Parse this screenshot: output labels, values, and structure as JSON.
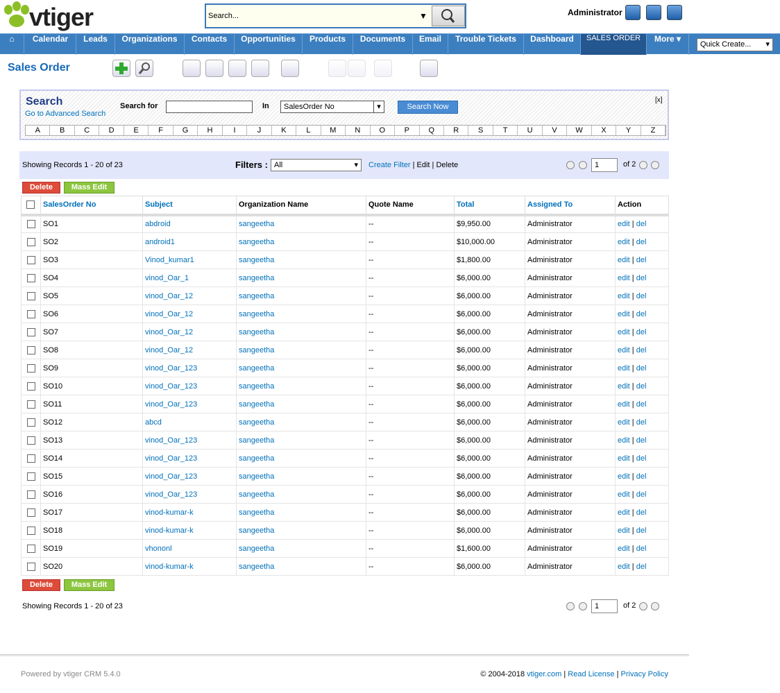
{
  "app": {
    "logo_text": "vtiger",
    "global_search_placeholder": "Search...",
    "user": "Administrator"
  },
  "nav": {
    "items": [
      "Calendar",
      "Leads",
      "Organizations",
      "Contacts",
      "Opportunities",
      "Products",
      "Documents",
      "Email",
      "Trouble Tickets",
      "Dashboard",
      "SALES ORDER",
      "More"
    ],
    "active": "SALES ORDER",
    "more_arrow": "▾",
    "quick_create": "Quick Create...",
    "home_icon": "house-icon"
  },
  "module": {
    "title": "Sales Order"
  },
  "search": {
    "title": "Search",
    "advanced_link": "Go to Advanced Search",
    "search_for_label": "Search for",
    "search_for_value": "",
    "in_label": "In",
    "in_value": "SalesOrder No",
    "button": "Search Now",
    "close": "[x]",
    "alphabet": [
      "A",
      "B",
      "C",
      "D",
      "E",
      "F",
      "G",
      "H",
      "I",
      "J",
      "K",
      "L",
      "M",
      "N",
      "O",
      "P",
      "Q",
      "R",
      "S",
      "T",
      "U",
      "V",
      "W",
      "X",
      "Y",
      "Z"
    ]
  },
  "filter": {
    "showing": "Showing Records 1 - 20 of 23",
    "label": "Filters :",
    "value": "All",
    "create": "Create Filter",
    "sep1": " | ",
    "edit": "Edit",
    "sep2": " | ",
    "delete": "Delete",
    "page": "1",
    "of": "of 2"
  },
  "actions": {
    "delete": "Delete",
    "mass_edit": "Mass Edit"
  },
  "table": {
    "headers": [
      "SalesOrder No",
      "Subject",
      "Organization Name",
      "Quote Name",
      "Total",
      "Assigned To",
      "Action"
    ],
    "action_edit": "edit",
    "action_sep": " | ",
    "action_del": "del",
    "rows": [
      [
        "SO1",
        "abdroid",
        "sangeetha",
        "--",
        "$9,950.00",
        "Administrator"
      ],
      [
        "SO2",
        "android1",
        "sangeetha",
        "--",
        "$10,000.00",
        "Administrator"
      ],
      [
        "SO3",
        "Vinod_kumar1",
        "sangeetha",
        "--",
        "$1,800.00",
        "Administrator"
      ],
      [
        "SO4",
        "vinod_Oar_1",
        "sangeetha",
        "--",
        "$6,000.00",
        "Administrator"
      ],
      [
        "SO5",
        "vinod_Oar_12",
        "sangeetha",
        "--",
        "$6,000.00",
        "Administrator"
      ],
      [
        "SO6",
        "vinod_Oar_12",
        "sangeetha",
        "--",
        "$6,000.00",
        "Administrator"
      ],
      [
        "SO7",
        "vinod_Oar_12",
        "sangeetha",
        "--",
        "$6,000.00",
        "Administrator"
      ],
      [
        "SO8",
        "vinod_Oar_12",
        "sangeetha",
        "--",
        "$6,000.00",
        "Administrator"
      ],
      [
        "SO9",
        "vinod_Oar_123",
        "sangeetha",
        "--",
        "$6,000.00",
        "Administrator"
      ],
      [
        "SO10",
        "vinod_Oar_123",
        "sangeetha",
        "--",
        "$6,000.00",
        "Administrator"
      ],
      [
        "SO11",
        "vinod_Oar_123",
        "sangeetha",
        "--",
        "$6,000.00",
        "Administrator"
      ],
      [
        "SO12",
        "abcd",
        "sangeetha",
        "--",
        "$6,000.00",
        "Administrator"
      ],
      [
        "SO13",
        "vinod_Oar_123",
        "sangeetha",
        "--",
        "$6,000.00",
        "Administrator"
      ],
      [
        "SO14",
        "vinod_Oar_123",
        "sangeetha",
        "--",
        "$6,000.00",
        "Administrator"
      ],
      [
        "SO15",
        "vinod_Oar_123",
        "sangeetha",
        "--",
        "$6,000.00",
        "Administrator"
      ],
      [
        "SO16",
        "vinod_Oar_123",
        "sangeetha",
        "--",
        "$6,000.00",
        "Administrator"
      ],
      [
        "SO17",
        "vinod-kumar-k",
        "sangeetha",
        "--",
        "$6,000.00",
        "Administrator"
      ],
      [
        "SO18",
        "vinod-kumar-k",
        "sangeetha",
        "--",
        "$6,000.00",
        "Administrator"
      ],
      [
        "SO19",
        "vhononl",
        "sangeetha",
        "--",
        "$1,600.00",
        "Administrator"
      ],
      [
        "SO20",
        "vinod-kumar-k",
        "sangeetha",
        "--",
        "$6,000.00",
        "Administrator"
      ]
    ]
  },
  "footer": {
    "powered": "Powered by vtiger CRM 5.4.0",
    "copyright": "© 2004-2018",
    "site": "vtiger.com",
    "sep1": " | ",
    "license": "Read License",
    "sep2": " | ",
    "privacy": "Privacy Policy"
  },
  "colors": {
    "nav": "#3c7fc0",
    "nav_active": "#24568f",
    "link": "#0070ba",
    "delete_btn": "#dd4b39",
    "mass_edit_btn": "#8cc63f"
  }
}
